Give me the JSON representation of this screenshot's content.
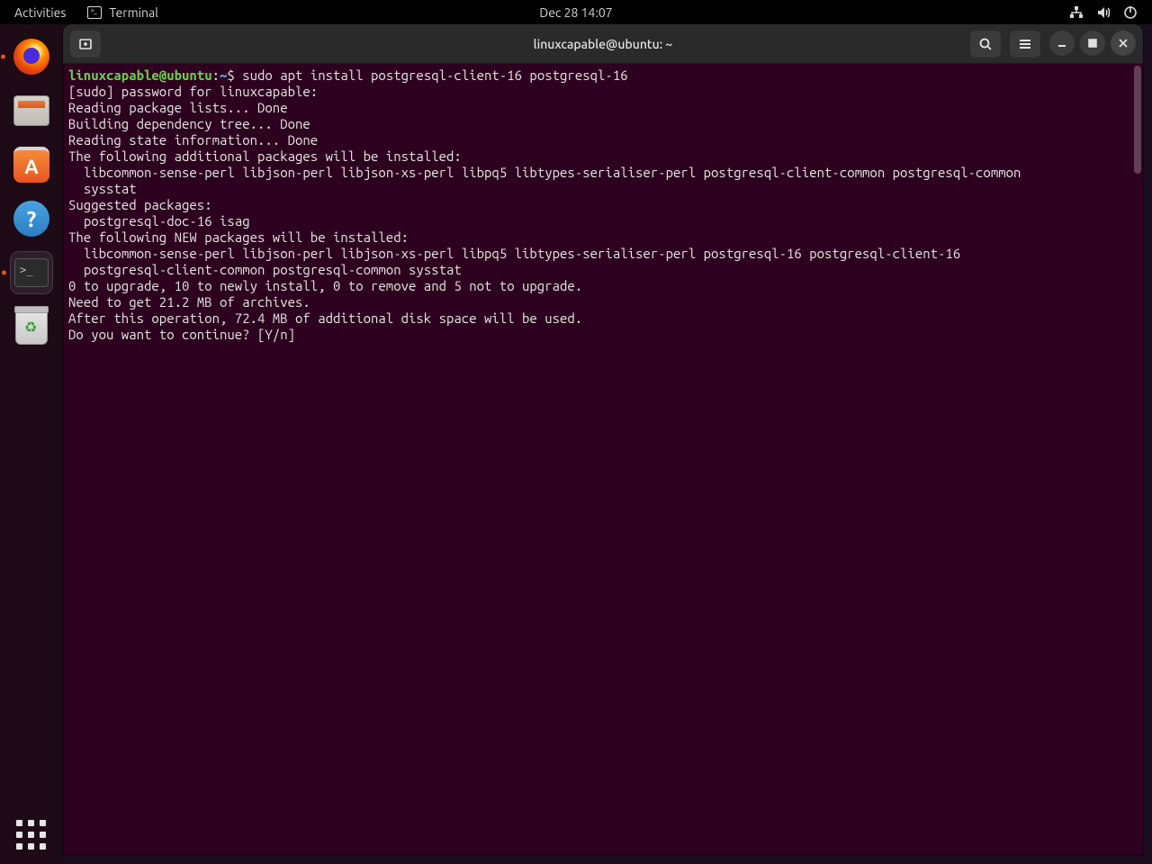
{
  "top_panel": {
    "activities": "Activities",
    "app_name": "Terminal",
    "clock": "Dec 28  14:07"
  },
  "dock": {
    "items": [
      {
        "name": "firefox"
      },
      {
        "name": "files"
      },
      {
        "name": "software"
      },
      {
        "name": "help"
      },
      {
        "name": "terminal"
      },
      {
        "name": "trash"
      }
    ]
  },
  "window": {
    "title": "linuxcapable@ubuntu: ~"
  },
  "terminal": {
    "prompt_user": "linuxcapable@ubuntu",
    "prompt_sep": ":",
    "prompt_path": "~",
    "prompt_dollar": "$ ",
    "command": "sudo apt install postgresql-client-16 postgresql-16",
    "lines": [
      "[sudo] password for linuxcapable:",
      "Reading package lists... Done",
      "Building dependency tree... Done",
      "Reading state information... Done",
      "The following additional packages will be installed:",
      "  libcommon-sense-perl libjson-perl libjson-xs-perl libpq5 libtypes-serialiser-perl postgresql-client-common postgresql-common",
      "  sysstat",
      "Suggested packages:",
      "  postgresql-doc-16 isag",
      "The following NEW packages will be installed:",
      "  libcommon-sense-perl libjson-perl libjson-xs-perl libpq5 libtypes-serialiser-perl postgresql-16 postgresql-client-16",
      "  postgresql-client-common postgresql-common sysstat",
      "0 to upgrade, 10 to newly install, 0 to remove and 5 not to upgrade.",
      "Need to get 21.2 MB of archives.",
      "After this operation, 72.4 MB of additional disk space will be used.",
      "Do you want to continue? [Y/n]"
    ]
  }
}
